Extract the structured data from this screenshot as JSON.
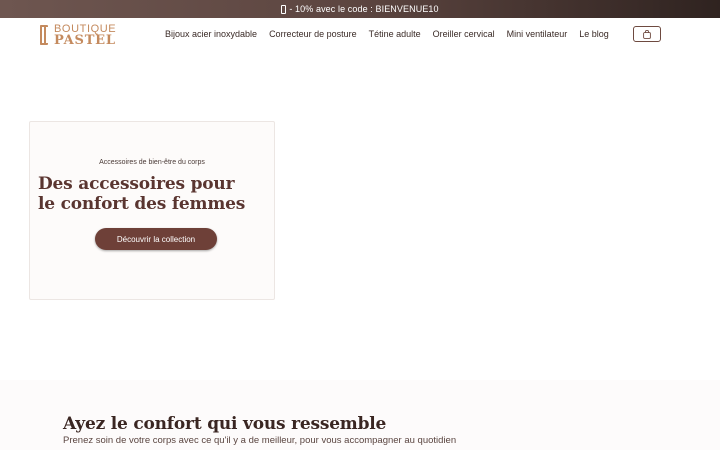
{
  "announcement": {
    "text": "- 10% avec le code : BIENVENUE10"
  },
  "logo": {
    "line1": "BOUTIQUE",
    "line2": "PASTEL"
  },
  "nav": {
    "items": [
      {
        "label": "Bijoux acier inoxydable"
      },
      {
        "label": "Correcteur de posture"
      },
      {
        "label": "Tétine adulte"
      },
      {
        "label": "Oreiller cervical"
      },
      {
        "label": "Mini ventilateur"
      },
      {
        "label": "Le blog"
      }
    ]
  },
  "icons": {
    "tag": "tag-icon",
    "cart": "shopping-bag-icon"
  },
  "hero": {
    "eyebrow": "Accessoires de bien-être du corps",
    "title_line1": "Des accessoires pour",
    "title_line2": "le confort des femmes",
    "cta_label": "Découvrir la collection"
  },
  "section": {
    "title": "Ayez le confort qui vous ressemble",
    "subtitle": "Prenez soin de votre corps avec ce qu'il y a de meilleur, pour vous accompagner au quotidien"
  },
  "colors": {
    "accent": "#c48a5e",
    "button": "#6e4038",
    "heading": "#5a3530",
    "announcement_bar": "#5c4540"
  }
}
